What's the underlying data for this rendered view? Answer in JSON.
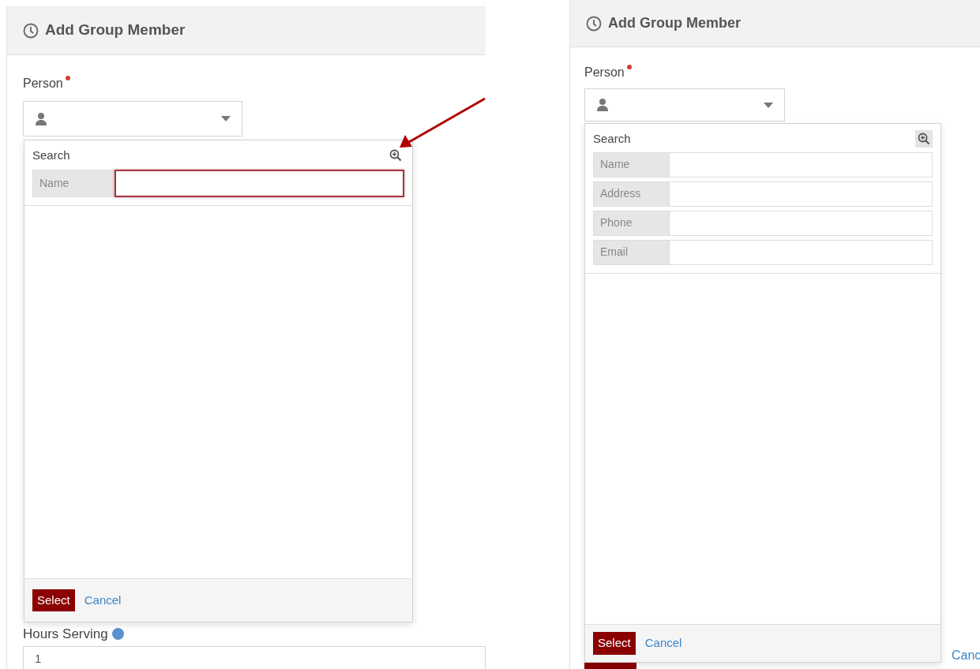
{
  "panels": [
    {
      "title": "Add Group Member",
      "person_label": "Person",
      "required": true,
      "popup": {
        "heading": "Search",
        "zoom_highlighted": false,
        "fields": [
          {
            "label": "Name",
            "focused": true
          }
        ],
        "select_button": "Select",
        "cancel_link": "Cancel"
      },
      "below": {
        "kind": "field",
        "label": "Hours Serving",
        "value": "1"
      }
    },
    {
      "title": "Add Group Member",
      "person_label": "Person",
      "required": true,
      "popup": {
        "heading": "Search",
        "zoom_highlighted": true,
        "fields": [
          {
            "label": "Name",
            "focused": false
          },
          {
            "label": "Address",
            "focused": false
          },
          {
            "label": "Phone",
            "focused": false
          },
          {
            "label": "Email",
            "focused": false
          }
        ],
        "select_button": "Select",
        "cancel_link": "Cancel"
      },
      "below": {
        "kind": "buttons",
        "link": "Canc"
      }
    }
  ]
}
